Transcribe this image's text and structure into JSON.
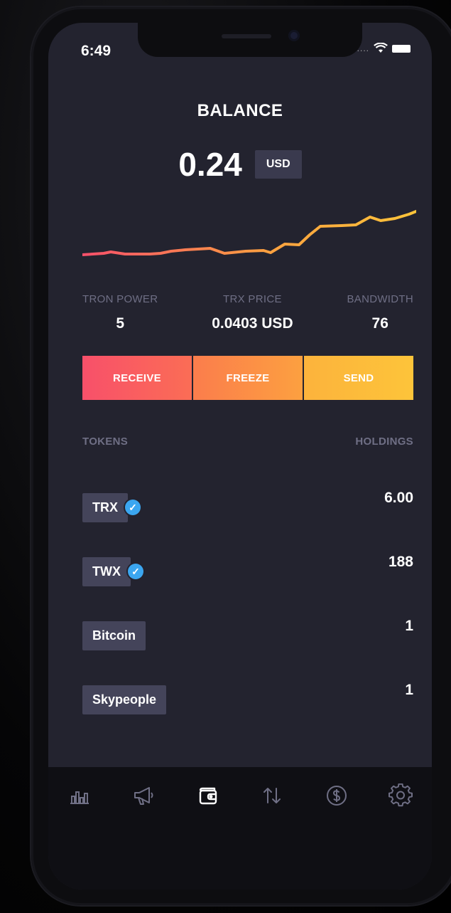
{
  "status_bar": {
    "time": "6:49",
    "signal": "....",
    "wifi": "ᯤ"
  },
  "balance": {
    "title": "BALANCE",
    "value": "0.24",
    "currency": "USD"
  },
  "sparkline": {
    "colors": [
      "#f8506a",
      "#fca040",
      "#fdc43a"
    ]
  },
  "stats": [
    {
      "label": "TRON POWER",
      "value": "5"
    },
    {
      "label": "TRX PRICE",
      "value": "0.0403 USD"
    },
    {
      "label": "BANDWIDTH",
      "value": "76"
    }
  ],
  "actions": {
    "receive": "RECEIVE",
    "freeze": "FREEZE",
    "send": "SEND"
  },
  "list_header": {
    "tokens": "TOKENS",
    "holdings": "HOLDINGS"
  },
  "tokens": [
    {
      "name": "TRX",
      "verified": true,
      "amount": "6.00"
    },
    {
      "name": "TWX",
      "verified": true,
      "amount": "188"
    },
    {
      "name": "Bitcoin",
      "verified": false,
      "amount": "1"
    },
    {
      "name": "Skypeople",
      "verified": false,
      "amount": "1"
    }
  ],
  "tabbar": {
    "icons": [
      "bar-chart-icon",
      "megaphone-icon",
      "wallet-icon",
      "transfer-arrows-icon",
      "dollar-coin-icon",
      "gear-icon"
    ],
    "active": "wallet-icon"
  }
}
